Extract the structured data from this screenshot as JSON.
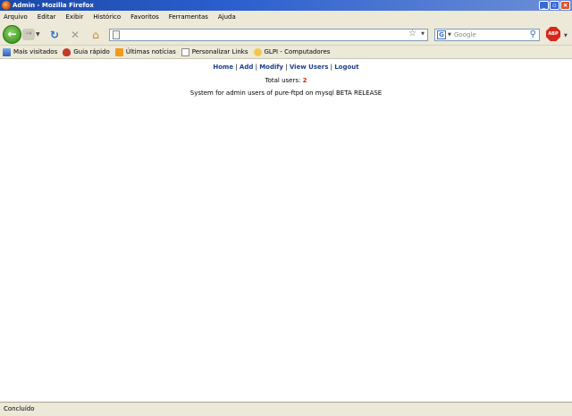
{
  "window": {
    "title": "Admin - Mozilla Firefox",
    "buttons": {
      "minimize": "_",
      "maximize": "▫",
      "close": "×"
    }
  },
  "menubar": [
    "Arquivo",
    "Editar",
    "Exibir",
    "Histórico",
    "Favoritos",
    "Ferramentas",
    "Ajuda"
  ],
  "navbar": {
    "search_placeholder": "Google",
    "search_engine_letter": "G",
    "adblock_label": "ABP"
  },
  "bookmarks": [
    {
      "label": "Mais visitados",
      "icon": "mais-visitados-icon"
    },
    {
      "label": "Guia rápido",
      "icon": "guia-rapido-icon"
    },
    {
      "label": "Últimas notícias",
      "icon": "rss-icon"
    },
    {
      "label": "Personalizar Links",
      "icon": "page-icon"
    },
    {
      "label": "GLPI - Computadores",
      "icon": "glpi-icon"
    }
  ],
  "content": {
    "links": [
      "Home",
      "Add",
      "Modify",
      "View Users",
      "Logout"
    ],
    "separator": "|",
    "total_label": "Total users:",
    "total_count": "2",
    "system_text": "System for admin users of pure-ftpd on mysql BETA RELEASE"
  },
  "status": {
    "text": "Concluído"
  },
  "colors": {
    "titlebar": "#2b5fcf",
    "chrome": "#ece9d8",
    "link": "#1d3f8c",
    "count": "#d2231a"
  }
}
